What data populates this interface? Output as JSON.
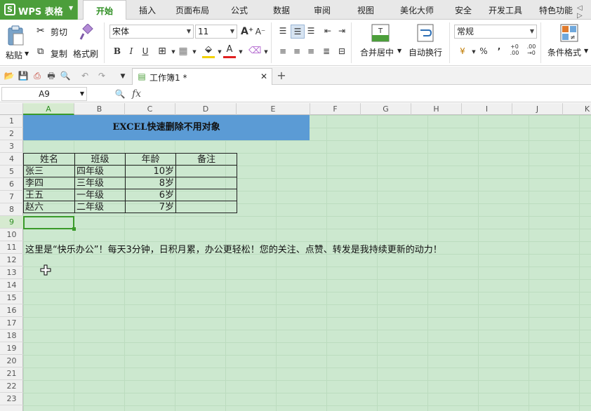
{
  "menu": {
    "app_name": "WPS 表格",
    "tabs": [
      "开始",
      "插入",
      "页面布局",
      "公式",
      "数据",
      "审阅",
      "视图",
      "美化大师",
      "安全",
      "开发工具",
      "特色功能"
    ],
    "active_tab": "开始"
  },
  "ribbon": {
    "paste": "粘贴",
    "cut": "剪切",
    "copy": "复制",
    "format_painter": "格式刷",
    "font_name": "宋体",
    "font_size": "11",
    "bold": "B",
    "italic": "I",
    "underline": "U",
    "merge_center": "合并居中",
    "wrap_text": "自动换行",
    "number_format": "常规",
    "conditional_format": "条件格式",
    "percent": "%",
    "comma": "’"
  },
  "document": {
    "tab_title": "工作簿1 *"
  },
  "formula_bar": {
    "name_box": "A9",
    "fx": "fx",
    "value": ""
  },
  "sheet": {
    "columns": [
      "A",
      "B",
      "C",
      "D",
      "E",
      "F",
      "G",
      "H",
      "I",
      "J",
      "K"
    ],
    "rows": [
      "1",
      "2",
      "3",
      "4",
      "5",
      "6",
      "7",
      "8",
      "9",
      "10",
      "11",
      "12",
      "13",
      "14",
      "15",
      "16",
      "17",
      "18",
      "19",
      "20",
      "21",
      "22",
      "23"
    ],
    "selected_col": "A",
    "selected_row": "9",
    "title": "EXCEL快速删除不用对象",
    "table_headers": [
      "姓名",
      "班级",
      "年龄",
      "备注"
    ],
    "table_rows": [
      [
        "张三",
        "四年级",
        "10岁",
        ""
      ],
      [
        "李四",
        "三年级",
        "8岁",
        ""
      ],
      [
        "王五",
        "一年级",
        "6岁",
        ""
      ],
      [
        "赵六",
        "二年级",
        "7岁",
        ""
      ]
    ],
    "note": "这里是“快乐办公”！每天3分钟，日积月累，办公更轻松！您的关注、点赞、转发是我持续更新的动力！"
  }
}
